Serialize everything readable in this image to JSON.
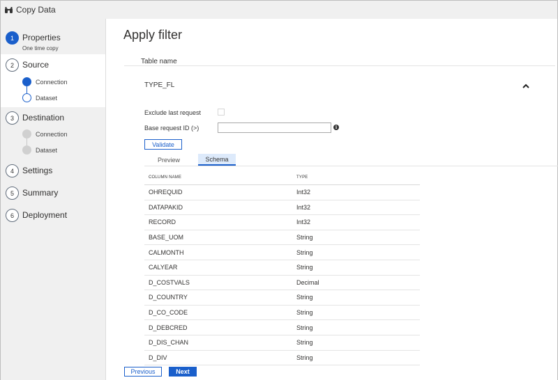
{
  "window": {
    "title": "Copy Data"
  },
  "sidebar": {
    "steps": [
      {
        "number": "1",
        "label": "Properties",
        "sub": "One time copy"
      },
      {
        "number": "2",
        "label": "Source"
      },
      {
        "number": "3",
        "label": "Destination"
      },
      {
        "number": "4",
        "label": "Settings"
      },
      {
        "number": "5",
        "label": "Summary"
      },
      {
        "number": "6",
        "label": "Deployment"
      }
    ],
    "source_substeps": [
      "Connection",
      "Dataset"
    ],
    "destination_substeps": [
      "Connection",
      "Dataset"
    ]
  },
  "main": {
    "title": "Apply filter",
    "section_label": "Table name",
    "table_name": "TYPE_FL",
    "exclude_label": "Exclude last request",
    "base_request_label": "Base request ID (>)",
    "base_request_value": "",
    "validate_label": "Validate",
    "tabs": {
      "preview": "Preview",
      "schema": "Schema"
    },
    "schema": {
      "headers": {
        "name": "COLUMN NAME",
        "type": "TYPE"
      },
      "rows": [
        {
          "name": "OHREQUID",
          "type": "Int32"
        },
        {
          "name": "DATAPAKID",
          "type": "Int32"
        },
        {
          "name": "RECORD",
          "type": "Int32"
        },
        {
          "name": "BASE_UOM",
          "type": "String"
        },
        {
          "name": "CALMONTH",
          "type": "String"
        },
        {
          "name": "CALYEAR",
          "type": "String"
        },
        {
          "name": "D_COSTVALS",
          "type": "Decimal"
        },
        {
          "name": "D_COUNTRY",
          "type": "String"
        },
        {
          "name": "D_CO_CODE",
          "type": "String"
        },
        {
          "name": "D_DEBCRED",
          "type": "String"
        },
        {
          "name": "D_DIS_CHAN",
          "type": "String"
        },
        {
          "name": "D_DIV",
          "type": "String"
        }
      ]
    },
    "footer": {
      "previous": "Previous",
      "next": "Next"
    }
  },
  "colors": {
    "accent": "#1a5fcb",
    "tab_selected_bg": "#ddeafb"
  }
}
